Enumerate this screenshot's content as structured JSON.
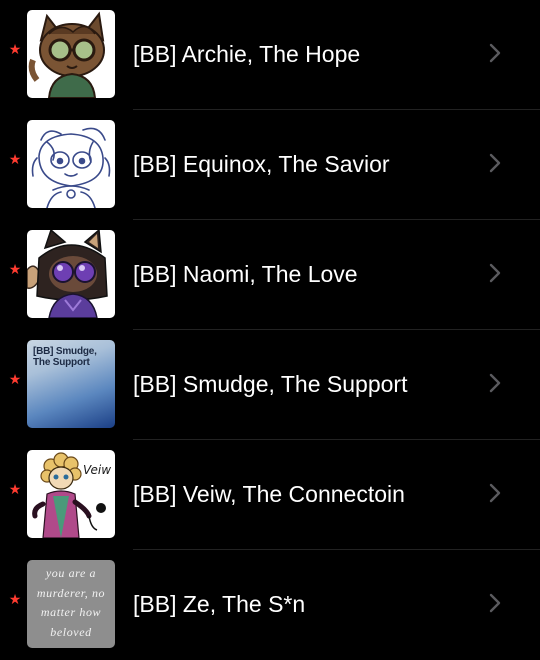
{
  "list": {
    "items": [
      {
        "title": "[BB] Archie, The Hope",
        "pinned": true,
        "thumbnail": "archie-art",
        "thumb_text": ""
      },
      {
        "title": "[BB] Equinox, The Savior",
        "pinned": true,
        "thumbnail": "equinox-sketch",
        "thumb_text": ""
      },
      {
        "title": "[BB] Naomi, The Love",
        "pinned": true,
        "thumbnail": "naomi-art",
        "thumb_text": ""
      },
      {
        "title": "[BB] Smudge, The Support",
        "pinned": true,
        "thumbnail": "smudge-gradient",
        "thumb_text": "[BB] Smudge, The Support"
      },
      {
        "title": "[BB] Veiw, The Connectoin",
        "pinned": true,
        "thumbnail": "veiw-art",
        "thumb_text": "Veiw"
      },
      {
        "title": "[BB] Ze, The S*n",
        "pinned": true,
        "thumbnail": "ze-quote",
        "thumb_text": "you are a murderer, no matter how beloved"
      }
    ]
  },
  "icons": {
    "star": "★",
    "chevron": "chevron-right-icon"
  },
  "colors": {
    "background": "#000000",
    "text": "#ffffff",
    "star": "#ff3b30",
    "chevron": "#5a5a5e",
    "divider": "#222222"
  }
}
